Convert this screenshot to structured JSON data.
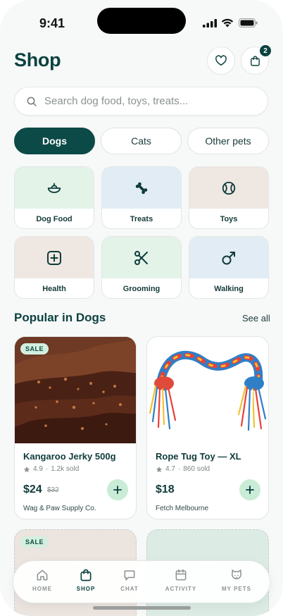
{
  "status_bar": {
    "time": "9:41"
  },
  "header": {
    "title": "Shop",
    "cart_count": "2"
  },
  "search": {
    "placeholder": "Search dog food, toys, treats..."
  },
  "pet_tabs": [
    {
      "label": "Dogs",
      "active": true
    },
    {
      "label": "Cats",
      "active": false
    },
    {
      "label": "Other pets",
      "active": false
    }
  ],
  "categories": [
    {
      "label": "Dog Food",
      "icon": "food-bowl-icon",
      "bg": "#e3f3e8"
    },
    {
      "label": "Treats",
      "icon": "bone-icon",
      "bg": "#e1ecf5"
    },
    {
      "label": "Toys",
      "icon": "ball-icon",
      "bg": "#efe7e1"
    },
    {
      "label": "Health",
      "icon": "health-plus-icon",
      "bg": "#efe7e1"
    },
    {
      "label": "Grooming",
      "icon": "scissors-icon",
      "bg": "#e3f3e8"
    },
    {
      "label": "Walking",
      "icon": "leash-icon",
      "bg": "#e1ecf5"
    }
  ],
  "section": {
    "title": "Popular in Dogs",
    "see_all": "See all"
  },
  "products": [
    {
      "badge": "SALE",
      "name": "Kangaroo Jerky 500g",
      "rating": "4.9",
      "sold": "1.2k sold",
      "price": "$24",
      "old_price": "$32",
      "seller": "Wag & Paw Supply Co."
    },
    {
      "badge": "",
      "name": "Rope Tug Toy — XL",
      "rating": "4.7",
      "sold": "860 sold",
      "price": "$18",
      "old_price": "",
      "seller": "Fetch Melbourne"
    }
  ],
  "more_products": [
    {
      "badge": "SALE"
    },
    {
      "badge": ""
    }
  ],
  "bottom_nav": [
    {
      "label": "HOME",
      "icon": "home-icon",
      "active": false
    },
    {
      "label": "SHOP",
      "icon": "shopping-bag-icon",
      "active": true
    },
    {
      "label": "CHAT",
      "icon": "chat-icon",
      "active": false
    },
    {
      "label": "ACTIVITY",
      "icon": "calendar-icon",
      "active": false
    },
    {
      "label": "MY PETS",
      "icon": "cat-face-icon",
      "active": false
    }
  ],
  "colors": {
    "primary": "#0c4a47",
    "accent_green": "#c9ecd6",
    "sale_badge": "#d3efe0",
    "background": "#f7f8f8"
  }
}
